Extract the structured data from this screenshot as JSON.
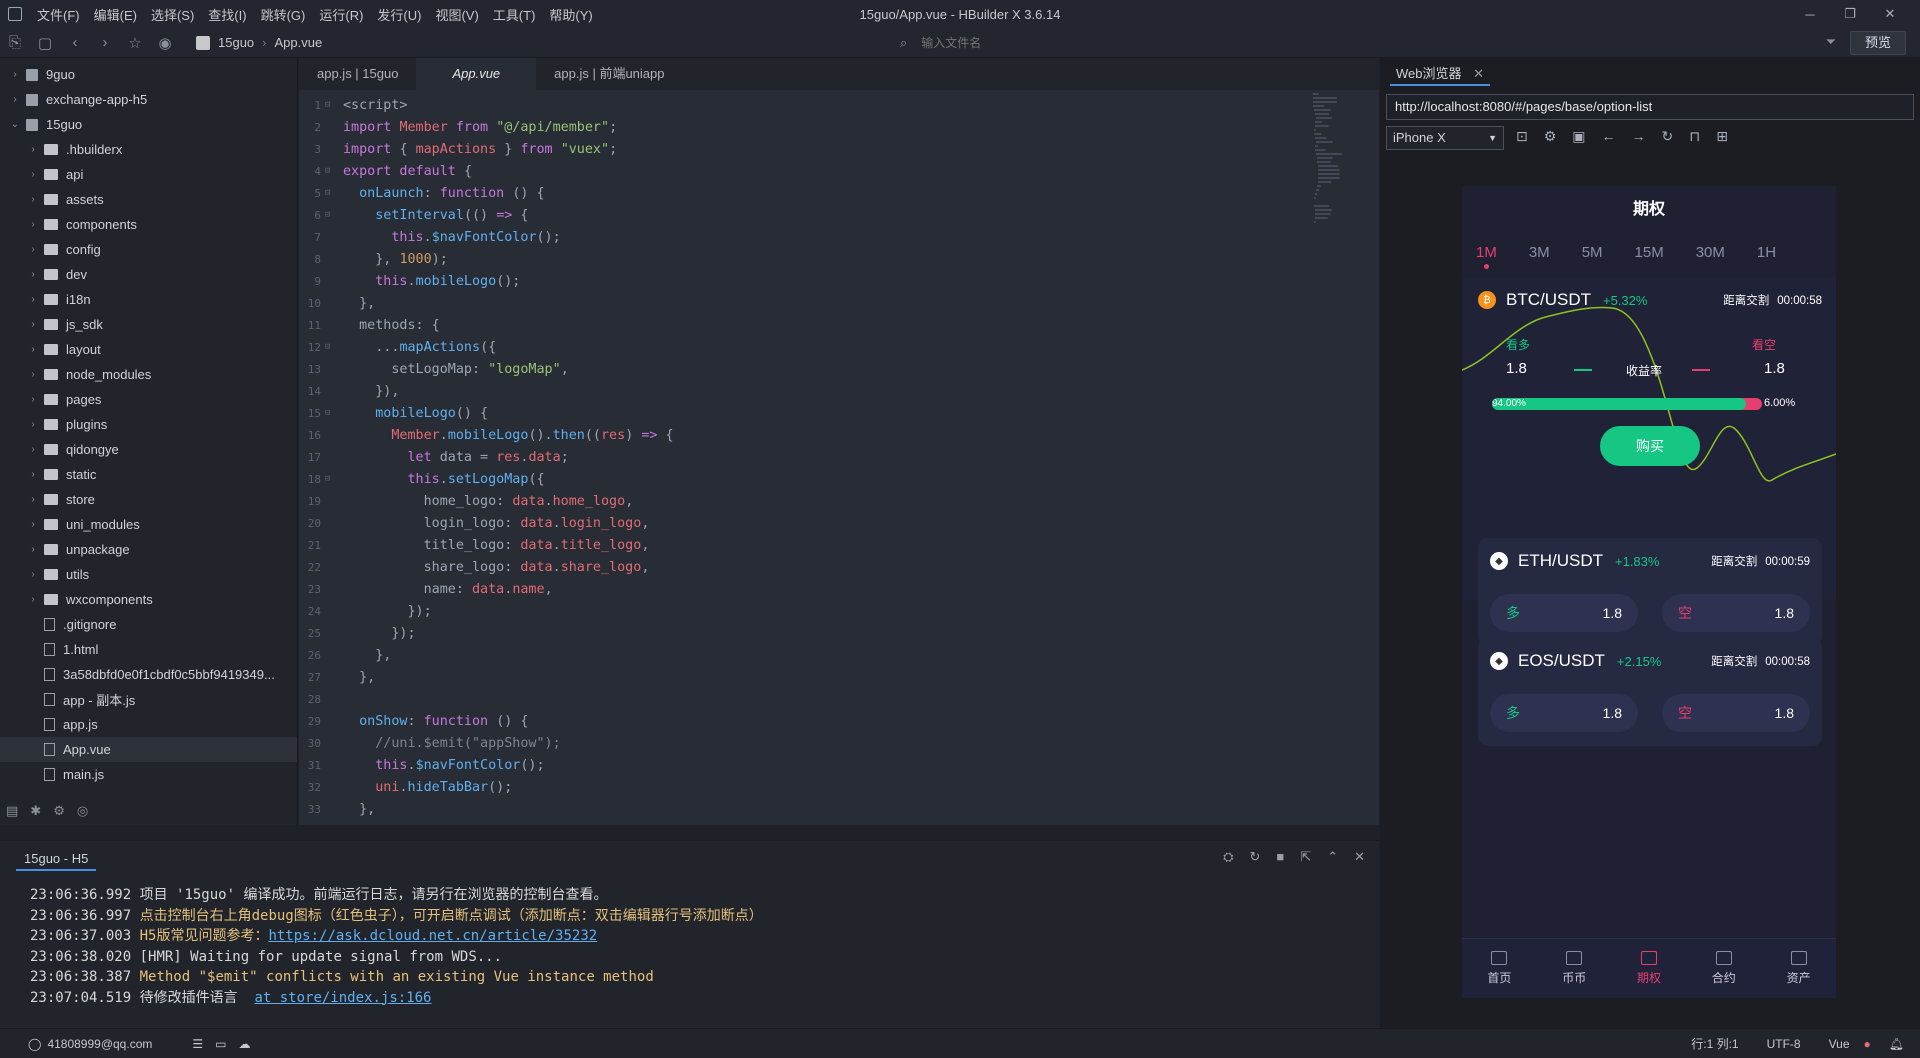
{
  "window": {
    "title": "15guo/App.vue - HBuilder X 3.6.14",
    "menu": [
      "文件(F)",
      "编辑(E)",
      "选择(S)",
      "查找(I)",
      "跳转(G)",
      "运行(R)",
      "发行(U)",
      "视图(V)",
      "工具(T)",
      "帮助(Y)"
    ]
  },
  "toolbar": {
    "breadcrumb": [
      "15guo",
      "App.vue"
    ],
    "search_placeholder": "输入文件名",
    "preview_label": "预览"
  },
  "sidebar": {
    "items": [
      {
        "label": "9guo",
        "type": "project",
        "level": 0,
        "chev": "›"
      },
      {
        "label": "exchange-app-h5",
        "type": "project",
        "level": 0,
        "chev": "›"
      },
      {
        "label": "15guo",
        "type": "project",
        "level": 0,
        "chev": "⌄"
      },
      {
        "label": ".hbuilderx",
        "type": "folder",
        "level": 1,
        "chev": "›"
      },
      {
        "label": "api",
        "type": "folder",
        "level": 1,
        "chev": "›"
      },
      {
        "label": "assets",
        "type": "folder",
        "level": 1,
        "chev": "›"
      },
      {
        "label": "components",
        "type": "folder",
        "level": 1,
        "chev": "›"
      },
      {
        "label": "config",
        "type": "folder",
        "level": 1,
        "chev": "›"
      },
      {
        "label": "dev",
        "type": "folder",
        "level": 1,
        "chev": "›"
      },
      {
        "label": "i18n",
        "type": "folder",
        "level": 1,
        "chev": "›"
      },
      {
        "label": "js_sdk",
        "type": "folder",
        "level": 1,
        "chev": "›"
      },
      {
        "label": "layout",
        "type": "folder",
        "level": 1,
        "chev": "›"
      },
      {
        "label": "node_modules",
        "type": "folder",
        "level": 1,
        "chev": "›"
      },
      {
        "label": "pages",
        "type": "folder",
        "level": 1,
        "chev": "›"
      },
      {
        "label": "plugins",
        "type": "folder",
        "level": 1,
        "chev": "›"
      },
      {
        "label": "qidongye",
        "type": "folder",
        "level": 1,
        "chev": "›"
      },
      {
        "label": "static",
        "type": "folder",
        "level": 1,
        "chev": "›"
      },
      {
        "label": "store",
        "type": "folder",
        "level": 1,
        "chev": "›"
      },
      {
        "label": "uni_modules",
        "type": "folder",
        "level": 1,
        "chev": "›"
      },
      {
        "label": "unpackage",
        "type": "folder",
        "level": 1,
        "chev": "›"
      },
      {
        "label": "utils",
        "type": "folder",
        "level": 1,
        "chev": "›"
      },
      {
        "label": "wxcomponents",
        "type": "folder",
        "level": 1,
        "chev": "›"
      },
      {
        "label": ".gitignore",
        "type": "file",
        "level": 1,
        "chev": ""
      },
      {
        "label": "1.html",
        "type": "file",
        "level": 1,
        "chev": ""
      },
      {
        "label": "3a58dbfd0e0f1cbdf0c5bbf9419349...",
        "type": "file",
        "level": 1,
        "chev": ""
      },
      {
        "label": "app - 副本.js",
        "type": "file",
        "level": 1,
        "chev": ""
      },
      {
        "label": "app.js",
        "type": "file",
        "level": 1,
        "chev": ""
      },
      {
        "label": "App.vue",
        "type": "file",
        "level": 1,
        "chev": "",
        "selected": true
      },
      {
        "label": "main.js",
        "type": "file",
        "level": 1,
        "chev": ""
      }
    ]
  },
  "editor": {
    "tabs": [
      "app.js | 15guo",
      "App.vue",
      "app.js | 前端uniapp"
    ],
    "active_tab": 1,
    "lines": [
      [
        [
          "t",
          "<script>"
        ]
      ],
      [
        [
          "k",
          "import "
        ],
        [
          "v",
          "Member "
        ],
        [
          "k",
          "from "
        ],
        [
          "s",
          "\"@/api/member\""
        ],
        [
          "t",
          ";"
        ]
      ],
      [
        [
          "k",
          "import "
        ],
        [
          "t",
          "{ "
        ],
        [
          "v",
          "mapActions "
        ],
        [
          "t",
          "} "
        ],
        [
          "k",
          "from "
        ],
        [
          "s",
          "\"vuex\""
        ],
        [
          "t",
          ";"
        ]
      ],
      [
        [
          "k",
          "export default "
        ],
        [
          "t",
          "{"
        ]
      ],
      [
        [
          "t",
          "  "
        ],
        [
          "f",
          "onLaunch"
        ],
        [
          "t",
          ": "
        ],
        [
          "k",
          "function "
        ],
        [
          "t",
          "() {"
        ]
      ],
      [
        [
          "t",
          "    "
        ],
        [
          "f",
          "setInterval"
        ],
        [
          "t",
          "(() "
        ],
        [
          "k",
          "=> "
        ],
        [
          "t",
          "{"
        ]
      ],
      [
        [
          "t",
          "      "
        ],
        [
          "k",
          "this"
        ],
        [
          "t",
          "."
        ],
        [
          "f",
          "$navFontColor"
        ],
        [
          "t",
          "();"
        ]
      ],
      [
        [
          "t",
          "    }, "
        ],
        [
          "n",
          "1000"
        ],
        [
          "t",
          ");"
        ]
      ],
      [
        [
          "t",
          "    "
        ],
        [
          "k",
          "this"
        ],
        [
          "t",
          "."
        ],
        [
          "f",
          "mobileLogo"
        ],
        [
          "t",
          "();"
        ]
      ],
      [
        [
          "t",
          "  },"
        ]
      ],
      [
        [
          "t",
          "  methods: {"
        ]
      ],
      [
        [
          "t",
          "    ..."
        ],
        [
          "f",
          "mapActions"
        ],
        [
          "t",
          "({"
        ]
      ],
      [
        [
          "t",
          "      setLogoMap: "
        ],
        [
          "s",
          "\"logoMap\""
        ],
        [
          "t",
          ","
        ]
      ],
      [
        [
          "t",
          "    }),"
        ]
      ],
      [
        [
          "t",
          "    "
        ],
        [
          "f",
          "mobileLogo"
        ],
        [
          "t",
          "() {"
        ]
      ],
      [
        [
          "t",
          "      "
        ],
        [
          "v",
          "Member"
        ],
        [
          "t",
          "."
        ],
        [
          "f",
          "mobileLogo"
        ],
        [
          "t",
          "()."
        ],
        [
          "f",
          "then"
        ],
        [
          "t",
          "(("
        ],
        [
          "v",
          "res"
        ],
        [
          "t",
          ") "
        ],
        [
          "k",
          "=> "
        ],
        [
          "t",
          "{"
        ]
      ],
      [
        [
          "t",
          "        "
        ],
        [
          "k",
          "let "
        ],
        [
          "t",
          "data = "
        ],
        [
          "v",
          "res"
        ],
        [
          "t",
          "."
        ],
        [
          "v",
          "data"
        ],
        [
          "t",
          ";"
        ]
      ],
      [
        [
          "t",
          "        "
        ],
        [
          "k",
          "this"
        ],
        [
          "t",
          "."
        ],
        [
          "f",
          "setLogoMap"
        ],
        [
          "t",
          "({"
        ]
      ],
      [
        [
          "t",
          "          home_logo: "
        ],
        [
          "v",
          "data"
        ],
        [
          "t",
          "."
        ],
        [
          "v",
          "home_logo"
        ],
        [
          "t",
          ","
        ]
      ],
      [
        [
          "t",
          "          login_logo: "
        ],
        [
          "v",
          "data"
        ],
        [
          "t",
          "."
        ],
        [
          "v",
          "login_logo"
        ],
        [
          "t",
          ","
        ]
      ],
      [
        [
          "t",
          "          title_logo: "
        ],
        [
          "v",
          "data"
        ],
        [
          "t",
          "."
        ],
        [
          "v",
          "title_logo"
        ],
        [
          "t",
          ","
        ]
      ],
      [
        [
          "t",
          "          share_logo: "
        ],
        [
          "v",
          "data"
        ],
        [
          "t",
          "."
        ],
        [
          "v",
          "share_logo"
        ],
        [
          "t",
          ","
        ]
      ],
      [
        [
          "t",
          "          name: "
        ],
        [
          "v",
          "data"
        ],
        [
          "t",
          "."
        ],
        [
          "v",
          "name"
        ],
        [
          "t",
          ","
        ]
      ],
      [
        [
          "t",
          "        });"
        ]
      ],
      [
        [
          "t",
          "      });"
        ]
      ],
      [
        [
          "t",
          "    },"
        ]
      ],
      [
        [
          "t",
          "  },"
        ]
      ],
      [
        [
          "t",
          ""
        ]
      ],
      [
        [
          "t",
          "  "
        ],
        [
          "f",
          "onShow"
        ],
        [
          "t",
          ": "
        ],
        [
          "k",
          "function "
        ],
        [
          "t",
          "() {"
        ]
      ],
      [
        [
          "t",
          "    "
        ],
        [
          "c",
          "//uni.$emit(\"appShow\");"
        ]
      ],
      [
        [
          "t",
          "    "
        ],
        [
          "k",
          "this"
        ],
        [
          "t",
          "."
        ],
        [
          "f",
          "$navFontColor"
        ],
        [
          "t",
          "();"
        ]
      ],
      [
        [
          "t",
          "    "
        ],
        [
          "v",
          "uni"
        ],
        [
          "t",
          "."
        ],
        [
          "f",
          "hideTabBar"
        ],
        [
          "t",
          "();"
        ]
      ],
      [
        [
          "t",
          "  },"
        ]
      ]
    ],
    "folds": [
      1,
      4,
      5,
      6,
      12,
      15,
      18
    ]
  },
  "console": {
    "tab_label": "15guo - H5",
    "lines": [
      {
        "time": "23:06:36.992",
        "text": "项目 '15guo' 编译成功。前端运行日志，请另行在浏览器的控制台查看。",
        "style": "w",
        "link": ""
      },
      {
        "time": "23:06:36.997",
        "text": "点击控制台右上角debug图标（红色虫子），可开启断点调试（添加断点：双击编辑器行号添加断点）",
        "style": "y",
        "link": ""
      },
      {
        "time": "23:06:37.003",
        "text": "H5版常见问题参考：",
        "style": "y",
        "link": "https://ask.dcloud.net.cn/article/35232"
      },
      {
        "time": "23:06:38.020",
        "text": "[HMR] Waiting for update signal from WDS...",
        "style": "w",
        "link": ""
      },
      {
        "time": "23:06:38.387",
        "text": "Method \"$emit\" conflicts with an existing Vue instance method",
        "style": "y",
        "link": ""
      },
      {
        "time": "23:07:04.519",
        "text": "待修改插件语言  ",
        "style": "w",
        "link": "at store/index.js:166"
      }
    ]
  },
  "statusbar": {
    "user": "41808999@qq.com",
    "position": "行:1  列:1",
    "encoding": "UTF-8",
    "language": "Vue"
  },
  "browser": {
    "tab_label": "Web浏览器",
    "url": "http://localhost:8080/#/pages/base/option-list",
    "device": "iPhone X",
    "app": {
      "title": "期权",
      "periods": [
        "1M",
        "3M",
        "5M",
        "15M",
        "30M",
        "1H"
      ],
      "active_period": "1M",
      "main": {
        "pair": "BTC/USDT",
        "change": "+5.32%",
        "countdown_label": "距离交割",
        "countdown": "00:00:58",
        "long_label": "看多",
        "short_label": "看空",
        "long_odds": "1.8",
        "short_odds": "1.8",
        "rate_label": "收益率",
        "long_pct": "94.00%",
        "short_pct": "6.00%",
        "long_fraction": 0.94,
        "buy_label": "购买"
      },
      "others": [
        {
          "pair": "ETH/USDT",
          "change": "+1.83%",
          "countdown_label": "距离交割",
          "countdown": "00:00:59",
          "long": "多",
          "short": "空",
          "long_odds": "1.8",
          "short_odds": "1.8"
        },
        {
          "pair": "EOS/USDT",
          "change": "+2.15%",
          "countdown_label": "距离交割",
          "countdown": "00:00:58",
          "long": "多",
          "short": "空",
          "long_odds": "1.8",
          "short_odds": "1.8"
        }
      ],
      "nav": [
        "首页",
        "币币",
        "期权",
        "合约",
        "资产"
      ],
      "active_nav": 2
    }
  },
  "colors": {
    "accent_green": "#16c784",
    "accent_red": "#e63f6f",
    "tab_blue": "#4a90e2"
  }
}
